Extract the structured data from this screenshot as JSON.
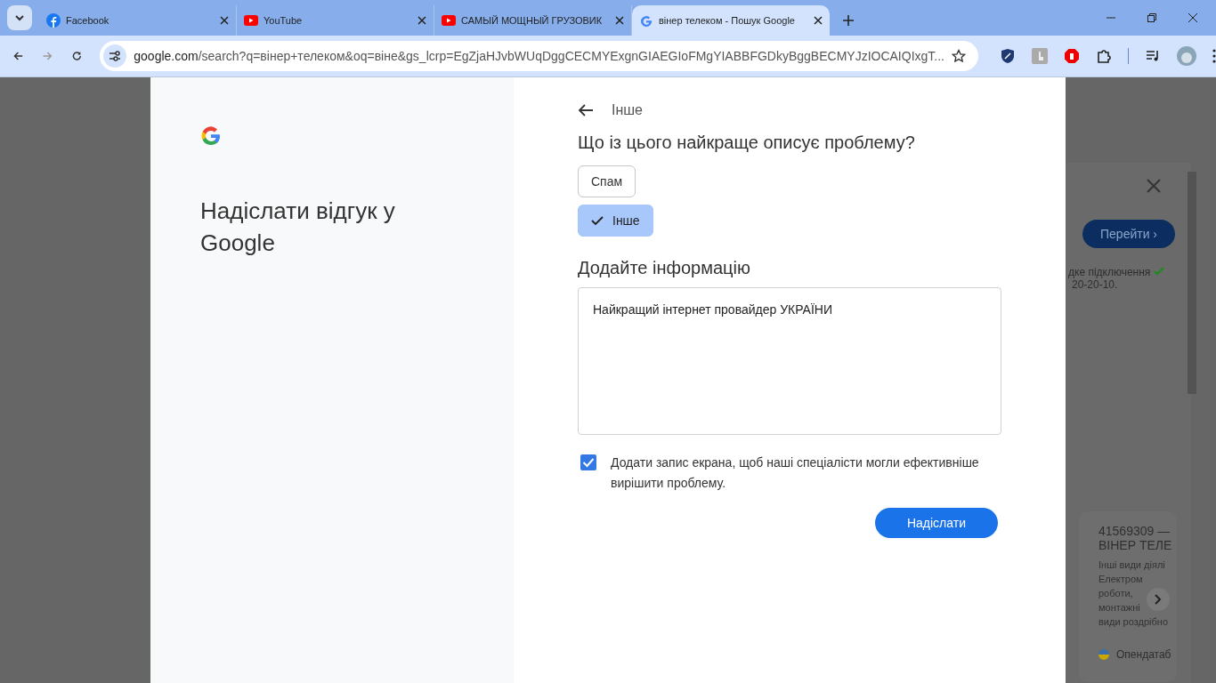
{
  "browser": {
    "tabs": [
      {
        "title": "Facebook",
        "kind": "facebook",
        "selected": false
      },
      {
        "title": "YouTube",
        "kind": "youtube",
        "selected": false
      },
      {
        "title": "САМЫЙ МОЩНЫЙ ГРУЗОВИК",
        "kind": "youtube",
        "selected": false
      },
      {
        "title": "вінер телеком - Пошук Google",
        "kind": "google",
        "selected": true
      }
    ],
    "address": {
      "host": "google.com",
      "path": "/search?q=вінер+телеком&oq=віне&gs_lcrp=EgZjaHJvbWUqDggCECMYExgnGIAEGIoFMgYIABBFGDkyBggBECMYJzIOCAIQIxgT..."
    }
  },
  "background_page": {
    "go_button": "Перейти ›",
    "info_lines": [
      "дке підключення",
      "20-20-10."
    ],
    "card": {
      "title_lines": [
        "41569309 —",
        "ВІНЕР ТЕЛЕ"
      ],
      "body_lines": [
        "Інші види діялі",
        "Електром",
        "роботи,",
        "монтажні",
        "види роздрібно"
      ],
      "source": "Опендатаб"
    }
  },
  "dialog": {
    "title": "Надіслати відгук у Google",
    "back_label": "Інше",
    "question": "Що із цього найкраще описує проблему?",
    "options": [
      {
        "label": "Спам",
        "selected": false
      },
      {
        "label": "Інше",
        "selected": true
      }
    ],
    "info_heading": "Додайте інформацію",
    "info_value": "Найкращий інтернет провайдер УКРАЇНИ",
    "screenshot_consent": {
      "label": "Додати запис екрана, щоб наші спеціалісти могли ефективніше вирішити проблему.",
      "checked": true
    },
    "submit": "Надіслати"
  }
}
